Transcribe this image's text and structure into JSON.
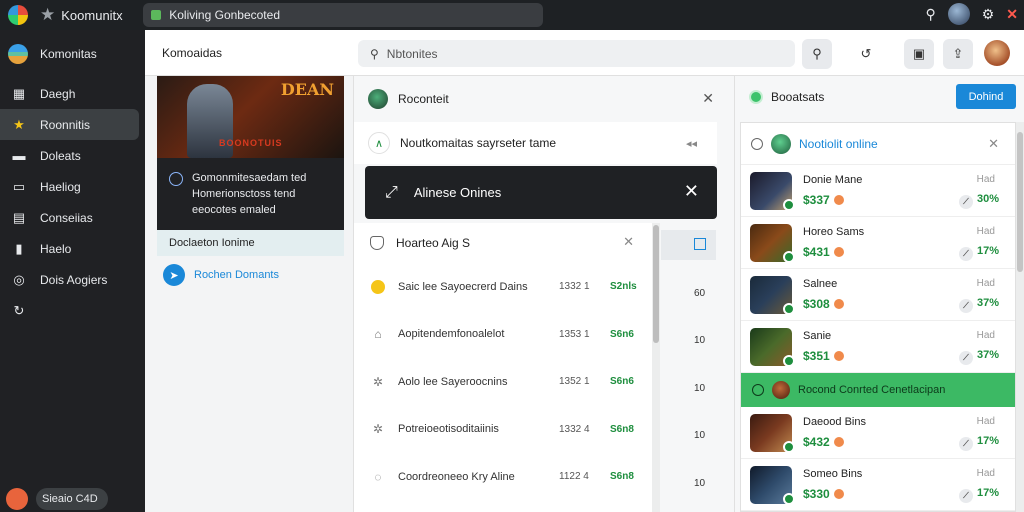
{
  "topbar": {
    "brand": "Koomunitx",
    "url": "Koliving Gonbecoted"
  },
  "sidebar": {
    "header": "Komonitas",
    "items": [
      {
        "label": "Daegh",
        "icon": "calendar-icon"
      },
      {
        "label": "Roonnitis",
        "icon": "star-icon"
      },
      {
        "label": "Doleats",
        "icon": "inbox-icon"
      },
      {
        "label": "Haeliog",
        "icon": "folder-icon"
      },
      {
        "label": "Conseiias",
        "icon": "card-icon"
      },
      {
        "label": "Haelo",
        "icon": "bookmark-icon"
      },
      {
        "label": "Dois Aogiers",
        "icon": "location-icon"
      },
      {
        "label": "",
        "icon": "refresh-icon"
      }
    ],
    "footer": "Sieaio C4D"
  },
  "header": {
    "title": "Komoaidas",
    "search_placeholder": "Nbtonites"
  },
  "col1": {
    "hero_title": "DEAN",
    "hero_sub": "BOONOTUIS",
    "dark_card": "Gomonmitesaedam ted Homerionsctoss tend eeocotes emaled",
    "light_row": "Doclaeton Ionime",
    "blue_row": "Rochen Domants"
  },
  "col2": {
    "head": "Roconteit",
    "notif": "Noutkomaitas sayrseter tame",
    "notif_more": "◂◂",
    "banner": "Alinese Onines",
    "list_title": "Hoarteo Aig S",
    "rows": [
      {
        "icon": "sun-icon",
        "label": "Saic lee Sayoecrerd Dains",
        "num": "1332 1",
        "amt": "S2nls",
        "side": "60"
      },
      {
        "icon": "user-icon",
        "label": "Aopitendemfonoalelot",
        "num": "1353 1",
        "amt": "S6n6",
        "side": "10"
      },
      {
        "icon": "puzzle-icon",
        "label": "Aolo lee Sayeroocnins",
        "num": "1352 1",
        "amt": "S6n6",
        "side": "10"
      },
      {
        "icon": "puzzle-icon",
        "label": "Potreioeotisoditaiinis",
        "num": "1332 4",
        "amt": "S6n8",
        "side": "10"
      },
      {
        "icon": "globe-icon",
        "label": "Coordreoneeo Kry Aline",
        "num": "1122 4",
        "amt": "S6n8",
        "side": "10"
      }
    ]
  },
  "col3": {
    "head": "Booatsats",
    "button": "Dohind",
    "online_title": "Nootiolit online",
    "games": [
      {
        "name": "Donie Mane",
        "price": "$337",
        "stat": "Had",
        "pct": "30%",
        "color": "#3a4a6a"
      },
      {
        "name": "Horeo Sams",
        "price": "$431",
        "stat": "Had",
        "pct": "17%",
        "color": "#8a4a1a"
      },
      {
        "name": "Salnee",
        "price": "$308",
        "stat": "Had",
        "pct": "37%",
        "color": "#2a3f5a"
      },
      {
        "name": "Sanie",
        "price": "$351",
        "stat": "Had",
        "pct": "37%",
        "color": "#4a6a2a"
      }
    ],
    "green_row": "Rocond Conrted Cenetlacipan",
    "games2": [
      {
        "name": "Daeood Bins",
        "price": "$432",
        "stat": "Had",
        "pct": "17%",
        "color": "#7a3a20"
      },
      {
        "name": "Someo Bins",
        "price": "$330",
        "stat": "Had",
        "pct": "17%",
        "color": "#2e4a6a"
      }
    ]
  },
  "colors": {
    "accent": "#1a88d8",
    "success": "#1e8e3e",
    "highlight": "#3cb964",
    "sidebar_bg": "#202124"
  }
}
